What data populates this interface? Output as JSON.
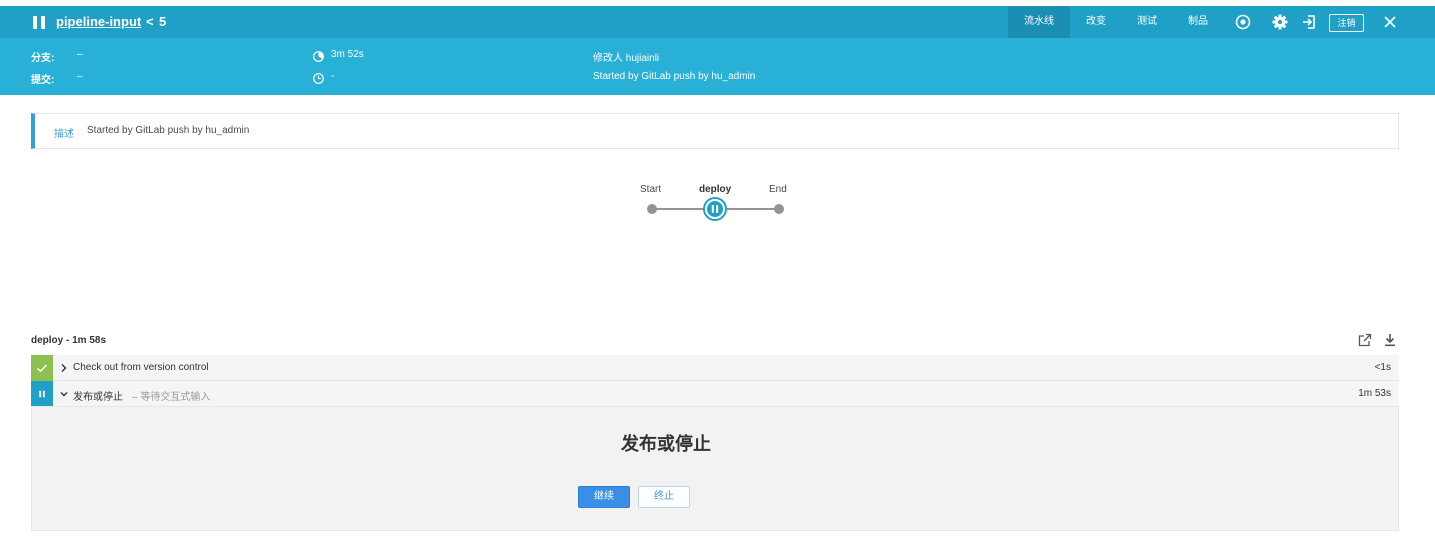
{
  "colors": {
    "topbar": "#1fa0c6",
    "header": "#29b0d6",
    "accent": "#3a9ed6",
    "success": "#8cc04f",
    "paused": "#1fa0c6",
    "primary_button": "#3a8ee6"
  },
  "topbar": {
    "status_icon": "pause-icon",
    "pipeline_name": "pipeline-input",
    "sep": "<",
    "run_number": "5",
    "tabs": [
      {
        "label": "流水线",
        "active": true
      },
      {
        "label": "改变",
        "active": false
      },
      {
        "label": "测试",
        "active": false
      },
      {
        "label": "制品",
        "active": false
      }
    ],
    "icons": [
      "replay-icon",
      "gear-icon",
      "login-icon",
      "close-icon"
    ],
    "logout_label": "注销"
  },
  "header": {
    "branch_label": "分支:",
    "branch_value": "–",
    "commit_label": "提交:",
    "commit_value": "–",
    "duration": "3m 52s",
    "started": "-",
    "changes": "修改人 hujiainli",
    "cause": "Started by GitLab push by hu_admin"
  },
  "description": {
    "label": "描述",
    "text": "Started by GitLab push by hu_admin"
  },
  "graph": {
    "nodes": [
      {
        "label": "Start",
        "state": "start"
      },
      {
        "label": "deploy",
        "state": "paused"
      },
      {
        "label": "End",
        "state": "end"
      }
    ]
  },
  "stage": {
    "title": "deploy - 1m 58s",
    "tools": [
      "open-external-icon",
      "download-icon"
    ],
    "steps": [
      {
        "status": "success",
        "name": "Check out from version control",
        "sub": "",
        "duration": "<1s",
        "expanded": false
      },
      {
        "status": "paused",
        "name": "发布或停止",
        "sub": "– 等待交互式输入",
        "duration": "1m 53s",
        "expanded": true
      }
    ]
  },
  "input_step": {
    "message": "发布或停止",
    "proceed_label": "继续",
    "abort_label": "终止"
  }
}
